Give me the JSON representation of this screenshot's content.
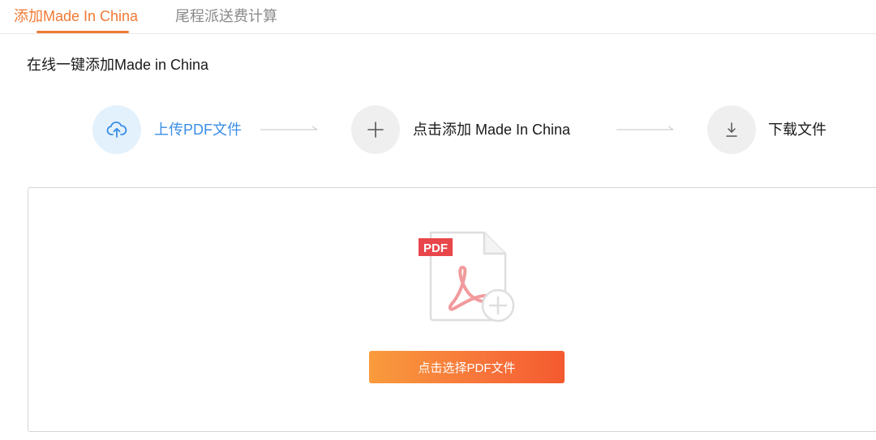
{
  "tabs": [
    {
      "label": "添加Made In China",
      "active": true
    },
    {
      "label": "尾程派送费计算",
      "active": false
    }
  ],
  "page_title": "在线一键添加Made in China",
  "steps": [
    {
      "label": "上传PDF文件",
      "icon": "cloud-upload-icon",
      "active": true
    },
    {
      "label": "点击添加 Made In China",
      "icon": "plus-icon",
      "active": false
    },
    {
      "label": "下载文件",
      "icon": "download-icon",
      "active": false
    }
  ],
  "upload": {
    "badge": "PDF",
    "button_label": "点击选择PDF文件"
  },
  "colors": {
    "accent": "#f07a35",
    "step_active": "#3a8ee6",
    "button_gradient_start": "#f99b3c",
    "button_gradient_end": "#f45a2f",
    "pdf_red": "#e8464b"
  }
}
